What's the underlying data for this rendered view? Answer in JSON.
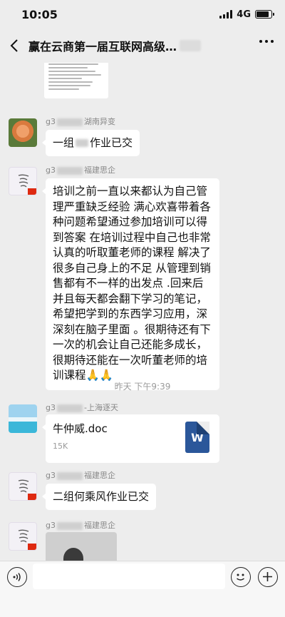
{
  "status_bar": {
    "time": "10:05",
    "network": "4G",
    "battery_level": 0.85
  },
  "header": {
    "title": "赢在云商第一届互联网高级…"
  },
  "messages": [
    {
      "sender_prefix": "g3",
      "sender_suffix": "湖南异变",
      "text": "一组",
      "text_suffix": "作业已交"
    },
    {
      "sender_prefix": "g3",
      "sender_suffix": "福建思企",
      "text": "培训之前一直以来都认为自己管理严重缺乏经验  满心欢喜带着各种问题希望通过参加培训可以得到答案  在培训过程中自己也非常认真的听取董老师的课程  解决了很多自己身上的不足  从管理到销售都有不一样的出发点 .回来后并且每天都会翻下学习的笔记，希望把学到的东西学习应用，深深刻在脑子里面 。很期待还有下一次的机会让自己还能多成长，很期待还能在一次听董老师的培训课程",
      "emoji": "🙏🙏"
    },
    {
      "sender_prefix": "g3",
      "sender_suffix": "-上海逐天",
      "file_name": "牛仲威.doc",
      "file_size": "15K",
      "file_icon_letter": "W"
    },
    {
      "sender_prefix": "g3",
      "sender_suffix": "福建思企",
      "text": "二组何乘风作业已交"
    },
    {
      "sender_prefix": "g3",
      "sender_suffix": "福建思企"
    }
  ],
  "time_divider": "昨天 下午9:39",
  "icons": {
    "back": "chevron-left-icon",
    "more": "more-dots-icon",
    "voice": "voice-icon",
    "emoji": "emoji-icon",
    "plus": "plus-icon",
    "word": "word-doc-icon"
  },
  "colors": {
    "background": "#ededed",
    "bubble": "#ffffff",
    "word_blue": "#2b579a",
    "flag_red": "#de2910"
  }
}
